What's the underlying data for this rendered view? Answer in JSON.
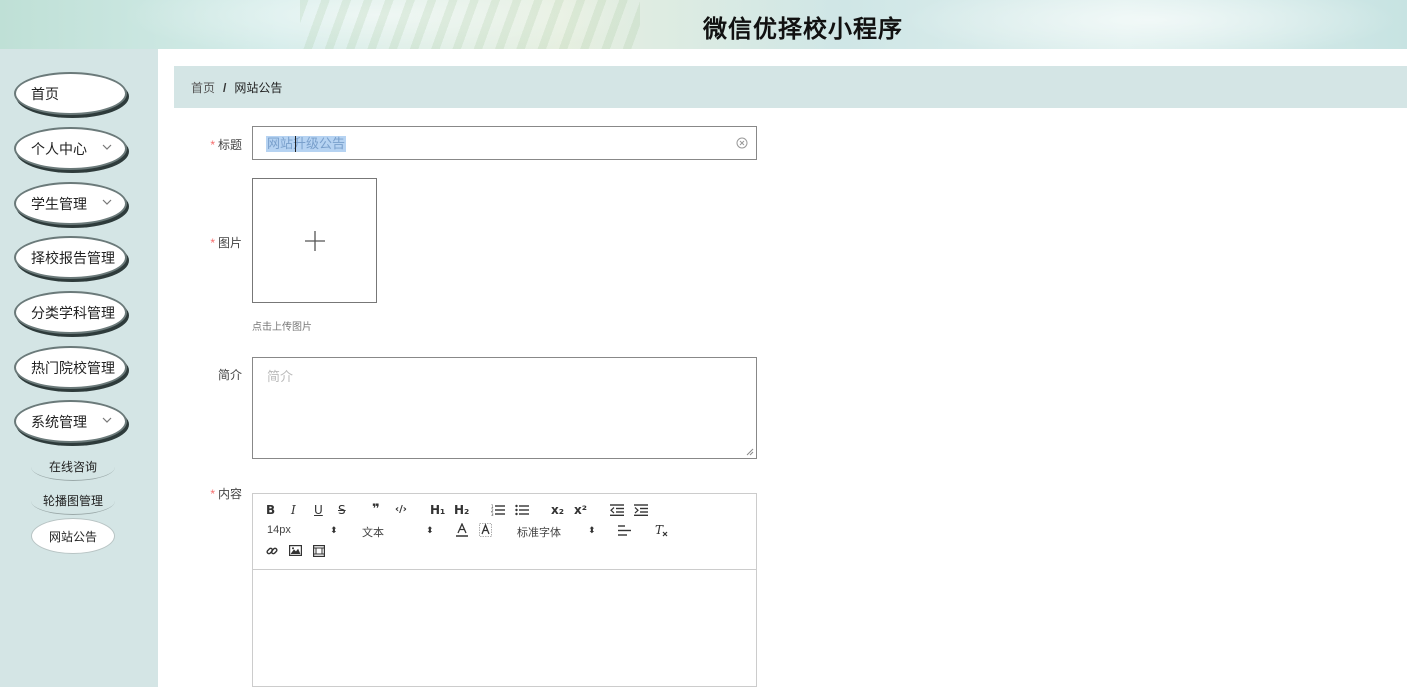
{
  "app": {
    "title": "微信优择校小程序"
  },
  "sidebar": {
    "items": [
      {
        "label": "首页",
        "has_children": false
      },
      {
        "label": "个人中心",
        "has_children": true
      },
      {
        "label": "学生管理",
        "has_children": true
      },
      {
        "label": "择校报告管理",
        "has_children": true
      },
      {
        "label": "分类学科管理",
        "has_children": true
      },
      {
        "label": "热门院校管理",
        "has_children": true
      },
      {
        "label": "系统管理",
        "has_children": true
      }
    ],
    "sub_items": [
      {
        "label": "在线咨询",
        "active": false
      },
      {
        "label": "轮播图管理",
        "active": false
      },
      {
        "label": "网站公告",
        "active": true
      }
    ]
  },
  "breadcrumb": {
    "home": "首页",
    "separator": "/",
    "current": "网站公告"
  },
  "form": {
    "title": {
      "label": "标题",
      "required": true,
      "value": "网站升级公告"
    },
    "image": {
      "label": "图片",
      "required": true,
      "tip": "点击上传图片"
    },
    "intro": {
      "label": "简介",
      "required": false,
      "placeholder": "简介"
    },
    "content": {
      "label": "内容",
      "required": true
    }
  },
  "editor_toolbar": {
    "bold": "B",
    "italic": "I",
    "underline": "U",
    "strike": "S",
    "quote": "❞",
    "code": "‹/›",
    "h1": "H₁",
    "h2": "H₂",
    "subscript": "x₂",
    "superscript": "x²",
    "font_size": "14px",
    "header_select": "文本",
    "font_family": "标准字体"
  },
  "colors": {
    "sidebar_bg": "#d4e5e5",
    "required_star": "#f56c6c",
    "selection": "#b6d3f2"
  }
}
